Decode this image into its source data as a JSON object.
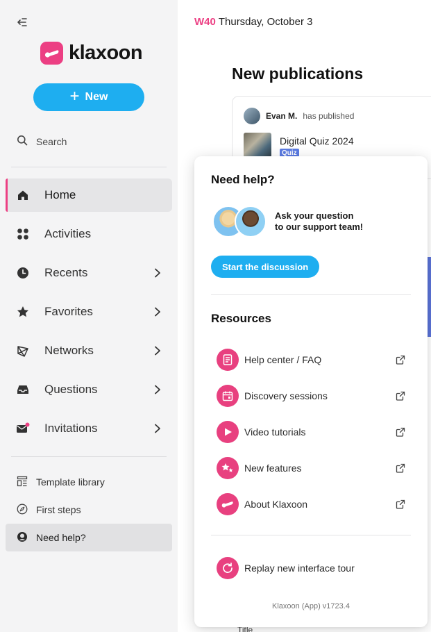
{
  "sidebar": {
    "logo_text": "klaxoon",
    "new_button": {
      "plus": "+",
      "label": "New"
    },
    "search_label": "Search",
    "nav": [
      {
        "label": "Home",
        "icon": "home-icon",
        "active": true,
        "chevron": false
      },
      {
        "label": "Activities",
        "icon": "activities-grid-icon",
        "active": false,
        "chevron": false
      },
      {
        "label": "Recents",
        "icon": "clock-icon",
        "active": false,
        "chevron": true
      },
      {
        "label": "Favorites",
        "icon": "star-icon",
        "active": false,
        "chevron": true
      },
      {
        "label": "Networks",
        "icon": "network-icon",
        "active": false,
        "chevron": true
      },
      {
        "label": "Questions",
        "icon": "inbox-icon",
        "active": false,
        "chevron": true
      },
      {
        "label": "Invitations",
        "icon": "mail-icon",
        "active": false,
        "chevron": true
      }
    ],
    "bottom_links": [
      {
        "label": "Template library",
        "icon": "template-icon",
        "active": false
      },
      {
        "label": "First steps",
        "icon": "compass-icon",
        "active": false
      },
      {
        "label": "Need help?",
        "icon": "help-icon",
        "active": true
      }
    ]
  },
  "main": {
    "week": "W40",
    "date": "Thursday, October 3",
    "section_title": "New publications",
    "publication": {
      "author": "Evan M.",
      "action": "has published",
      "title": "Digital Quiz 2024",
      "tag": "Quiz"
    },
    "partial_text": "Title"
  },
  "help_popover": {
    "title": "Need help?",
    "ask_line1": "Ask your question",
    "ask_line2": "to our support team!",
    "start_button": "Start the discussion",
    "resources_title": "Resources",
    "resources": [
      {
        "label": "Help center / FAQ",
        "icon": "document-icon"
      },
      {
        "label": "Discovery sessions",
        "icon": "calendar-icon"
      },
      {
        "label": "Video tutorials",
        "icon": "play-icon"
      },
      {
        "label": "New features",
        "icon": "sparkle-stars-icon"
      },
      {
        "label": "About Klaxoon",
        "icon": "klaxoon-logo-icon"
      }
    ],
    "replay_label": "Replay new interface tour",
    "version": "Klaxoon (App) v1723.4"
  },
  "colors": {
    "brand_pink": "#ec3f83",
    "accent_blue": "#1eaef0",
    "quiz_tag": "#5b7be3"
  }
}
